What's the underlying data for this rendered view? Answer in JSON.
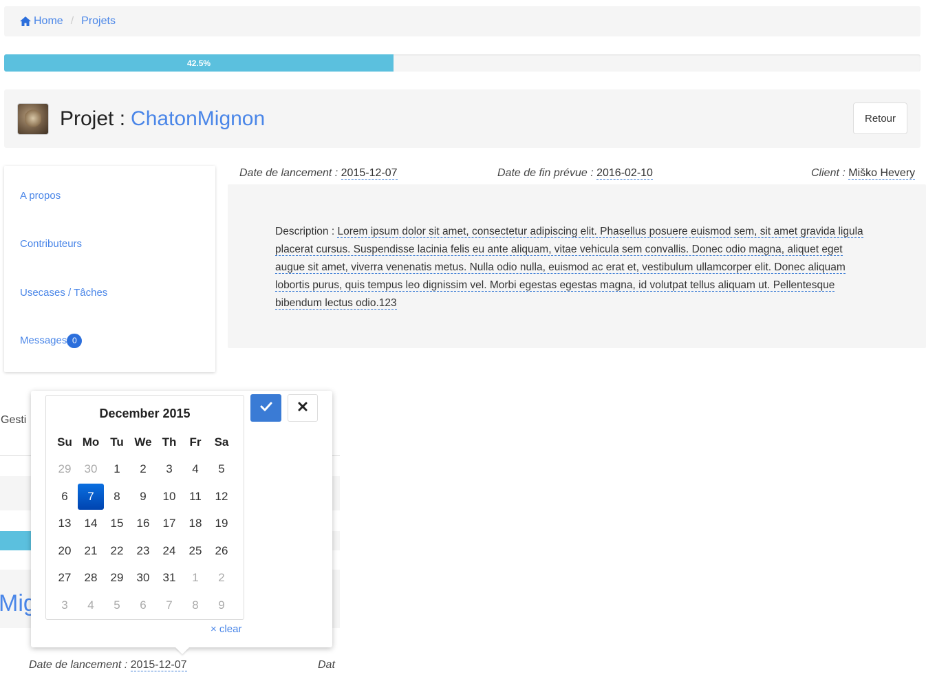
{
  "breadcrumb": {
    "home": "Home",
    "separator": "/",
    "current": "Projets",
    "home_icon": "home-icon"
  },
  "progress": {
    "label": "42.5%",
    "value": 0.425,
    "color": "#5bc0de"
  },
  "project": {
    "title_prefix": "Projet :",
    "name": "ChatonMignon",
    "back_button": "Retour"
  },
  "sidenav": {
    "items": [
      {
        "label": "A propos"
      },
      {
        "label": "Contributeurs"
      },
      {
        "label": "Usecases / Tâches"
      },
      {
        "label": "Messages",
        "badge": "0"
      }
    ]
  },
  "info": {
    "launch_label": "Date de lancement :",
    "launch_value": "2015-12-07",
    "end_label": "Date de fin prévue :",
    "end_value": "2016-02-10",
    "client_label": "Client :",
    "client_value": "Miško Hevery"
  },
  "description": {
    "label": "Description :",
    "text": "Lorem ipsum dolor sit amet, consectetur adipiscing elit. Phasellus posuere euismod sem, sit amet gravida ligula placerat cursus. Suspendisse lacinia felis eu ante aliquam, vitae vehicula sem convallis. Donec odio magna, aliquet eget augue sit amet, viverra venenatis metus. Nulla odio nulla, euismod ac erat et, vestibulum ullamcorper elit. Donec aliquam lobortis purus, quis tempus leo dignissim vel. Morbi egestas egestas magna, id volutpat tellus aliquam ut. Pellentesque bibendum lectus odio.123"
  },
  "ghost": {
    "gesti": "Gesti",
    "mig": "Mig",
    "launch_label": "Date de lancement :",
    "launch_value": "2015-12-07",
    "dat": "Dat"
  },
  "datepicker": {
    "title": "December 2015",
    "weekdays": [
      "Su",
      "Mo",
      "Tu",
      "We",
      "Th",
      "Fr",
      "Sa"
    ],
    "weeks": [
      [
        "29",
        "30",
        "1",
        "2",
        "3",
        "4",
        "5"
      ],
      [
        "6",
        "7",
        "8",
        "9",
        "10",
        "11",
        "12"
      ],
      [
        "13",
        "14",
        "15",
        "16",
        "17",
        "18",
        "19"
      ],
      [
        "20",
        "21",
        "22",
        "23",
        "24",
        "25",
        "26"
      ],
      [
        "27",
        "28",
        "29",
        "30",
        "31",
        "1",
        "2"
      ],
      [
        "3",
        "4",
        "5",
        "6",
        "7",
        "8",
        "9"
      ]
    ],
    "selected": "7",
    "clear_label": "× clear",
    "ok_icon": "check-icon",
    "cancel_icon": "close-icon"
  }
}
